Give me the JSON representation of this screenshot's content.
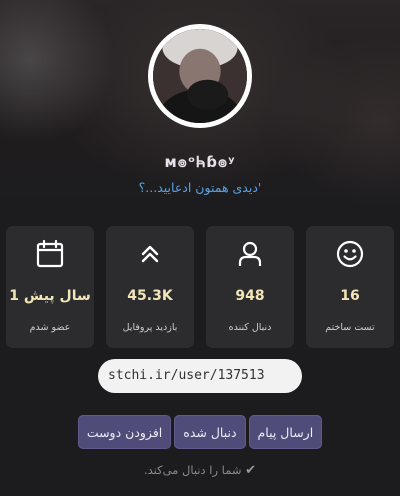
{
  "profile": {
    "username": "ᴍ๏ᵒᏂ̶ɓ๏ʸ",
    "bio": "'دیدی همتون ادعایید...؟"
  },
  "stats": [
    {
      "icon": "smiley-icon",
      "value": "16",
      "label": "تست ساختم"
    },
    {
      "icon": "user-icon",
      "value": "948",
      "label": "دنبال کننده"
    },
    {
      "icon": "double-chevron-up-icon",
      "value": "45.3K",
      "label": "بازدید پروفایل"
    },
    {
      "icon": "calendar-icon",
      "value": "1 سال پیش",
      "label": "عضو شدم"
    }
  ],
  "profile_url": "stchi.ir/user/137513",
  "actions": {
    "send_message": "ارسال پیام",
    "followed": "دنبال شده",
    "add_friend": "افزودن دوست"
  },
  "follow_status": "شما را دنبال می‌کند.",
  "colors": {
    "background": "#1c1c1e",
    "card": "#2c2c2e",
    "value": "#f2e6b8",
    "bio": "#5aa0e6",
    "button": "#4f4c7a"
  }
}
